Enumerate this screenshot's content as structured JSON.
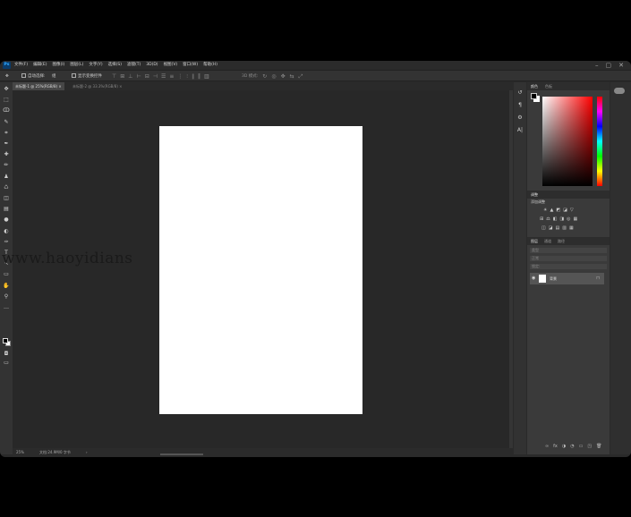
{
  "app": {
    "logo": "Ps",
    "menu": [
      "文件(F)",
      "编辑(E)",
      "图像(I)",
      "图层(L)",
      "文字(Y)",
      "选择(S)",
      "滤镜(T)",
      "3D(D)",
      "视图(V)",
      "窗口(W)",
      "帮助(H)"
    ],
    "window_controls": [
      "–",
      "▢",
      "✕"
    ]
  },
  "options_bar": {
    "move_tool_icon": "move-icon",
    "auto_select_label": "自动选择:",
    "auto_select_value": "组",
    "show_transform_label": "显示变换控件",
    "mode_3d_label": "3D 模式:"
  },
  "tabs": [
    {
      "label": "未标题-1 @ 25%(RGB/8) ×",
      "active": true
    },
    {
      "label": "未标题-2 @ 33.3%(RGB/8) ×",
      "active": false
    }
  ],
  "toolbar": {
    "tools": [
      "move-icon",
      "marquee-icon",
      "lasso-icon",
      "quick-select-icon",
      "crop-icon",
      "eyedropper-icon",
      "healing-brush-icon",
      "brush-icon",
      "clone-stamp-icon",
      "history-brush-icon",
      "eraser-icon",
      "gradient-icon",
      "blur-icon",
      "dodge-icon",
      "pen-icon",
      "type-icon",
      "path-select-icon",
      "rectangle-icon",
      "hand-icon",
      "zoom-icon",
      "more-tools-icon"
    ],
    "glyphs": [
      "✥",
      "⬚",
      "ↀ",
      "✎",
      "⌗",
      "✒",
      "✚",
      "✏",
      "♟",
      "♺",
      "◫",
      "▤",
      "●",
      "◐",
      "✑",
      "T",
      "↖",
      "▭",
      "✋",
      "⚲",
      "…"
    ],
    "fg_color": "#000000",
    "bg_color": "#ffffff"
  },
  "document": {
    "canvas_color": "#ffffff"
  },
  "status": {
    "zoom": "25%",
    "doc_info": "文档:24.9M/0 字节",
    "arrow": "›"
  },
  "watermark": "www.haoyidians",
  "side_icons": [
    "history-icon",
    "paragraph-icon",
    "properties-icon",
    "character-icon"
  ],
  "side_glyphs": [
    "↺",
    "¶",
    "⚙",
    "A|"
  ],
  "panels": {
    "color_tabs": [
      "颜色",
      "色板"
    ],
    "adjust_tab": "调整",
    "adjust_subtitle": "添加调整",
    "adjust_row1": [
      "☀",
      "▲",
      "◩",
      "◪",
      "▽"
    ],
    "adjust_row2": [
      "⊞",
      "⚖",
      "◧",
      "◨",
      "◎",
      "▦"
    ],
    "adjust_row3": [
      "◫",
      "◪",
      "▤",
      "▥",
      "▦"
    ],
    "layers_tabs": [
      "图层",
      "通道",
      "路径"
    ],
    "layer_kind": "类型",
    "layer_mode": "正常",
    "layer_lock": "锁定:",
    "layer_name": "背景",
    "layer_lock_icon": "🔒",
    "layer_eye_icon": "👁",
    "footer_icons": [
      "∞",
      "fx",
      "◑",
      "◔",
      "▭",
      "◳",
      "🗑"
    ]
  },
  "cloud_icon": "cc-cloud-icon"
}
